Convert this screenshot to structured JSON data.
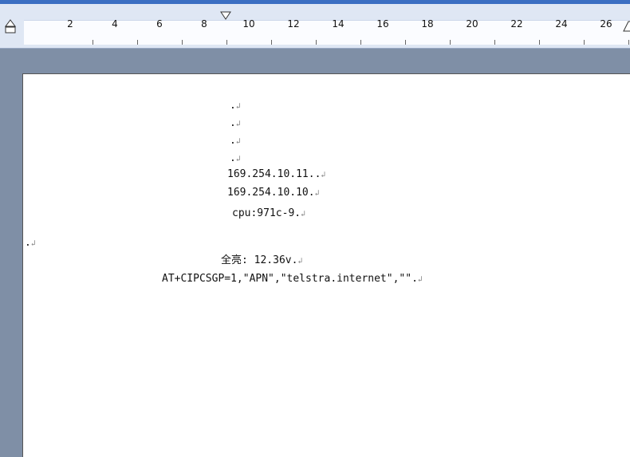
{
  "ruler": {
    "labels": [
      "2",
      "4",
      "6",
      "8",
      "10",
      "12",
      "14",
      "16",
      "18",
      "20",
      "22",
      "24",
      "26"
    ]
  },
  "document": {
    "lines": [
      {
        "text": ".",
        "mark": "↲"
      },
      {
        "text": ".",
        "mark": "↲"
      },
      {
        "text": ".",
        "mark": "↲"
      },
      {
        "text": ".",
        "mark": "↲"
      },
      {
        "text": "169.254.10.11..",
        "mark": "↲"
      },
      {
        "text": "169.254.10.10.",
        "mark": "↲"
      },
      {
        "text": "cpu:971c-9.",
        "mark": "↲"
      },
      {
        "text": ".",
        "mark": "↲"
      },
      {
        "text": "全亮: 12.36v.",
        "mark": "↲"
      },
      {
        "text": "AT+CIPCSGP=1,\"APN\",\"telstra.internet\",\"\".",
        "mark": "↲"
      }
    ]
  },
  "colors": {
    "title_blue": "#3b6fc2",
    "gray": "#7f8fa6",
    "page": "#ffffff"
  }
}
